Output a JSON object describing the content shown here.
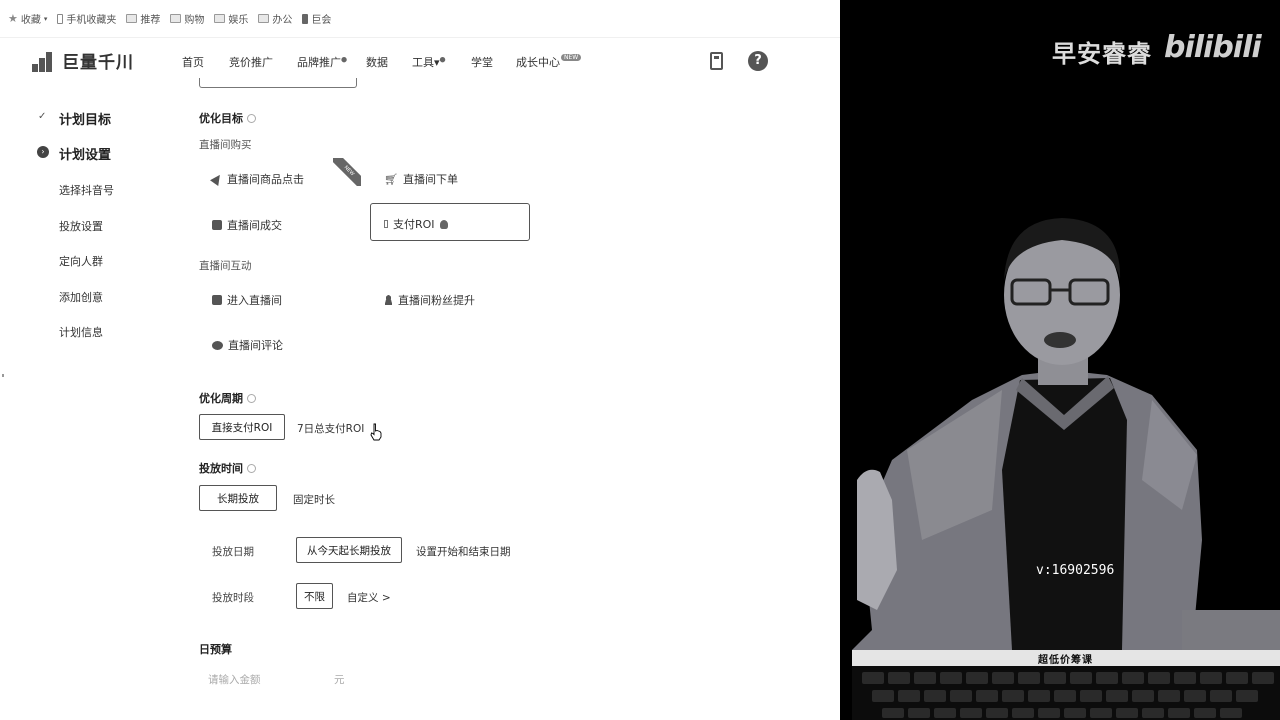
{
  "bookmarks": [
    {
      "label": "收藏",
      "icon": "star-icon"
    },
    {
      "label": "手机收藏夹",
      "icon": "phone-icon"
    },
    {
      "label": "推荐",
      "icon": "folder-icon"
    },
    {
      "label": "购物",
      "icon": "folder-icon"
    },
    {
      "label": "娱乐",
      "icon": "folder-icon"
    },
    {
      "label": "办公",
      "icon": "folder-icon"
    },
    {
      "label": "巨会",
      "icon": "page-icon"
    }
  ],
  "header": {
    "brand": "巨量千川",
    "nav": [
      {
        "label": "首页"
      },
      {
        "label": "竞价推广"
      },
      {
        "label": "品牌推广",
        "mark": "●"
      },
      {
        "label": "数据"
      },
      {
        "label": "工具",
        "suffix": "▾",
        "mark": "●"
      },
      {
        "label": "学堂"
      },
      {
        "label": "成长中心",
        "badge": "NEW"
      }
    ]
  },
  "steps": {
    "plan_target": "计划目标",
    "plan_settings": "计划设置",
    "sub": [
      "选择抖音号",
      "投放设置",
      "定向人群",
      "添加创意",
      "计划信息"
    ]
  },
  "form": {
    "opt_target_title": "优化目标",
    "group_buy": "直播间购买",
    "opt_click": "直播间商品点击",
    "opt_order": "直播间下单",
    "opt_deal": "直播间成交",
    "opt_roi": "支付ROI",
    "ribbon": "NEW",
    "group_interact": "直播间互动",
    "opt_enter": "进入直播间",
    "opt_fans": "直播间粉丝提升",
    "opt_comment": "直播间评论",
    "cycle_title": "优化周期",
    "cycle_direct": "直接支付ROI",
    "cycle_7day": "7日总支付ROI",
    "time_title": "投放时间",
    "time_long": "长期投放",
    "time_fixed": "固定时长",
    "date_label": "投放日期",
    "date_value": "从今天起长期投放",
    "date_custom": "设置开始和结束日期",
    "period_label": "投放时段",
    "period_value": "不限",
    "period_custom": "自定义 >",
    "budget_title": "日预算",
    "budget_placeholder": "请输入金额",
    "budget_unit": "元"
  },
  "video": {
    "streamer_name": "早安睿睿",
    "platform_logo": "bilibili",
    "watermark": "v:16902596",
    "caption": "超低价筹课"
  }
}
